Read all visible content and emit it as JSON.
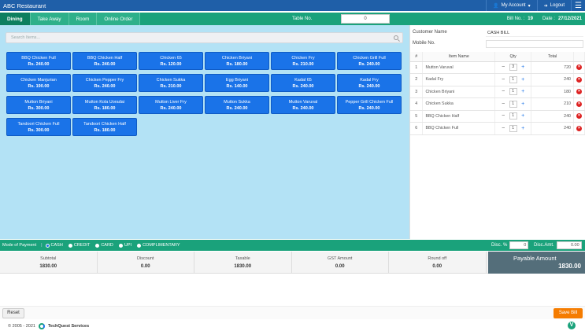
{
  "app": {
    "title": "ABC Restaurant"
  },
  "topbar": {
    "account_label": "My Account",
    "logout_label": "Logout",
    "menu_icon": "hamburger-icon"
  },
  "tabs": [
    "Dining",
    "Take Away",
    "Room",
    "Online Order"
  ],
  "table": {
    "label": "Table No.",
    "value": "0"
  },
  "bill": {
    "no_label": "Bill No. :",
    "no_value": "19",
    "date_label": "Date :",
    "date_value": "27/12/2021"
  },
  "search": {
    "placeholder": "Search Items..."
  },
  "menu_items": [
    {
      "name": "BBQ Chicken Full",
      "price": "Rs. 240.00"
    },
    {
      "name": "BBQ Chicken Half",
      "price": "Rs. 240.00"
    },
    {
      "name": "Chicken 65",
      "price": "Rs. 120.00"
    },
    {
      "name": "Chicken Briyani",
      "price": "Rs. 180.00"
    },
    {
      "name": "Chicken Fry",
      "price": "Rs. 210.00"
    },
    {
      "name": "Chicken Grill Full",
      "price": "Rs. 240.00"
    },
    {
      "name": "Chicken Manjurian",
      "price": "Rs. 190.00"
    },
    {
      "name": "Chicken Pepper Fry",
      "price": "Rs. 240.00"
    },
    {
      "name": "Chicken Sukka",
      "price": "Rs. 210.00"
    },
    {
      "name": "Egg Briyani",
      "price": "Rs. 140.00"
    },
    {
      "name": "Kadal 65",
      "price": "Rs. 240.00"
    },
    {
      "name": "Kadal Fry",
      "price": "Rs. 240.00"
    },
    {
      "name": "Mutton Briyani",
      "price": "Rs. 300.00"
    },
    {
      "name": "Mutton Kola Uoradai",
      "price": "Rs. 180.00"
    },
    {
      "name": "Mutton Liver Fry",
      "price": "Rs. 240.00"
    },
    {
      "name": "Mutton Sukka",
      "price": "Rs. 240.00"
    },
    {
      "name": "Mutton Varuval",
      "price": "Rs. 240.00"
    },
    {
      "name": "Pepper Grill Chicken Full",
      "price": "Rs. 240.00"
    },
    {
      "name": "Tandoori Chicken Full",
      "price": "Rs. 300.00"
    },
    {
      "name": "Tandoori Chicken Half",
      "price": "Rs. 180.00"
    }
  ],
  "customer": {
    "name_label": "Customer Name",
    "name_value": "CASH BILL",
    "mobile_label": "Mobile No.",
    "mobile_value": ""
  },
  "order_table": {
    "headers": [
      "#",
      "Item Name",
      "Qty",
      "Total"
    ],
    "rows": [
      {
        "idx": "1",
        "name": "Mutton Varuval",
        "qty": "3",
        "total": "720"
      },
      {
        "idx": "2",
        "name": "Kadal Fry",
        "qty": "1",
        "total": "240"
      },
      {
        "idx": "3",
        "name": "Chicken Briyani",
        "qty": "1",
        "total": "180"
      },
      {
        "idx": "4",
        "name": "Chicken Sukka",
        "qty": "1",
        "total": "210"
      },
      {
        "idx": "5",
        "name": "BBQ Chicken Half",
        "qty": "1",
        "total": "240"
      },
      {
        "idx": "6",
        "name": "BBQ Chicken Full",
        "qty": "1",
        "total": "240"
      }
    ]
  },
  "payment": {
    "label": "Mode of Payment",
    "options": [
      "CASH",
      "CREDIT",
      "CARD",
      "UPI",
      "COMPLIMENTARY"
    ],
    "selected": "CASH",
    "disc_pct_label": "Disc. %",
    "disc_pct_value": "0",
    "disc_amt_label": "Disc.Amt.",
    "disc_amt_value": "0.00"
  },
  "summary": [
    {
      "label": "Subtotal",
      "value": "1830.00"
    },
    {
      "label": "Discount",
      "value": "0.00"
    },
    {
      "label": "Taxable",
      "value": "1830.00"
    },
    {
      "label": "GST Amount",
      "value": "0.00"
    },
    {
      "label": "Round off",
      "value": "0.00"
    }
  ],
  "payable": {
    "label": "Payable Amount",
    "value": "1830.00"
  },
  "actions": {
    "reset_label": "Reset",
    "save_label": "Save Bill"
  },
  "footer": {
    "copyright": "© 2005 - 2021",
    "company": "TechQuest Services"
  },
  "colors": {
    "brand": "#1f5fa8",
    "green": "#1aa27b",
    "item_blue": "#1a73e8",
    "save_orange": "#f57c00",
    "payable_bg": "#546e7a",
    "menu_bg": "#b3e2f5"
  }
}
